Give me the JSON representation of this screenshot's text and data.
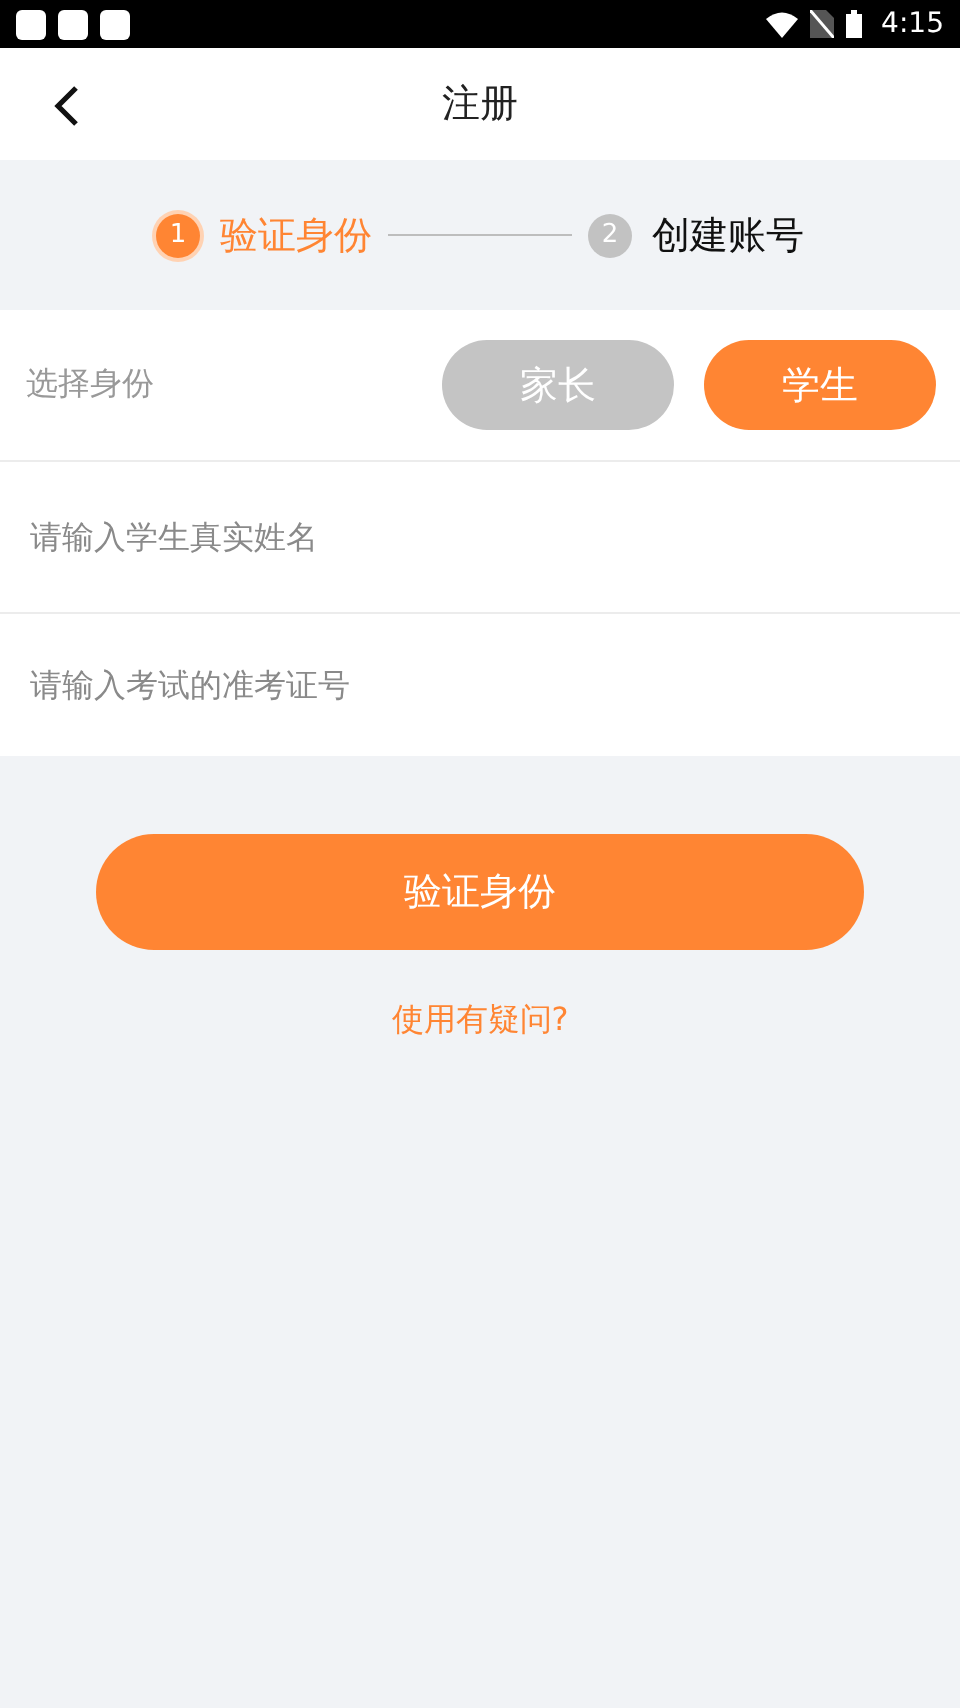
{
  "status_bar": {
    "time": "4:15"
  },
  "header": {
    "title": "注册"
  },
  "steps": [
    {
      "number": "1",
      "label": "验证身份",
      "selected": true
    },
    {
      "number": "2",
      "label": "创建账号",
      "selected": false
    }
  ],
  "role": {
    "label": "选择身份",
    "options": [
      {
        "label": "家长",
        "selected": false
      },
      {
        "label": "学生",
        "selected": true
      }
    ]
  },
  "fields": [
    {
      "placeholder": "请输入学生真实姓名"
    },
    {
      "placeholder": "请输入考试的准考证号"
    }
  ],
  "submit_button": "验证身份",
  "help_link": "使用有疑问?"
}
